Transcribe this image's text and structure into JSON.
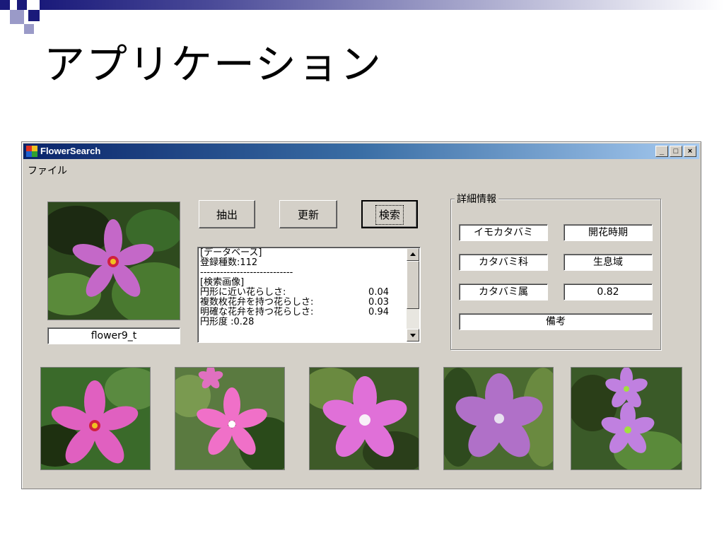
{
  "slide": {
    "title": "アプリケーション"
  },
  "window": {
    "title": "FlowerSearch",
    "controls": {
      "minimize": "_",
      "maximize": "□",
      "close": "×"
    }
  },
  "menu": {
    "file": "ファイル"
  },
  "query_image": {
    "filename": "flower9_t"
  },
  "buttons": {
    "extract": "抽出",
    "update": "更新",
    "search": "検索"
  },
  "log": {
    "db_header": "[データベース]",
    "species_count": "登録種数:112",
    "separator": "----------------------------",
    "search_header": "[検索画像]",
    "rows": [
      {
        "label": "円形に近い花らしさ:",
        "value": "0.04"
      },
      {
        "label": "複数枚花弁を持つ花らしさ:",
        "value": "0.03"
      },
      {
        "label": "明確な花弁を持つ花らしさ:",
        "value": "0.94"
      }
    ],
    "roundness": "円形度 :0.28"
  },
  "details": {
    "group_label": "詳細情報",
    "name": "イモカタバミ",
    "bloom_period": "開花時期",
    "family": "カタバミ科",
    "habitat": "生息域",
    "genus": "カタバミ属",
    "score": "0.82",
    "notes": "備考"
  },
  "colors": {
    "window_bg": "#d4d0c8",
    "titlebar_start": "#0a246a",
    "titlebar_end": "#a6caf0",
    "slide_accent": "#1a1a7a"
  }
}
